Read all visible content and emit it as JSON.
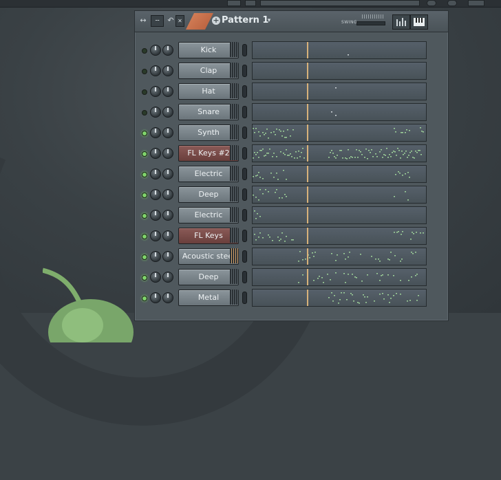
{
  "window": {
    "pattern_name": "Pattern 1",
    "swing_label": "SWING",
    "title_icons": [
      "resize-icon",
      "pattern-options-icon",
      "undo-icon",
      "close-icon",
      "arrow-icon"
    ]
  },
  "channels": [
    {
      "name": "Kick",
      "active": false,
      "style": "normal",
      "grip": "normal",
      "notes": "sparse"
    },
    {
      "name": "Clap",
      "active": false,
      "style": "normal",
      "grip": "normal",
      "notes": "none"
    },
    {
      "name": "Hat",
      "active": false,
      "style": "normal",
      "grip": "normal",
      "notes": "sparse"
    },
    {
      "name": "Snare",
      "active": false,
      "style": "normal",
      "grip": "normal",
      "notes": "sparse"
    },
    {
      "name": "Synth",
      "active": true,
      "style": "normal",
      "grip": "normal",
      "notes": "dense-edges"
    },
    {
      "name": "FL Keys #2",
      "active": true,
      "style": "red",
      "grip": "normal",
      "notes": "dense"
    },
    {
      "name": "Electric",
      "active": true,
      "style": "normal",
      "grip": "normal",
      "notes": "edges"
    },
    {
      "name": "Deep",
      "active": true,
      "style": "normal",
      "grip": "normal",
      "notes": "edges"
    },
    {
      "name": "Electric",
      "active": true,
      "style": "normal",
      "grip": "normal",
      "notes": "left"
    },
    {
      "name": "FL Keys",
      "active": true,
      "style": "red",
      "grip": "normal",
      "notes": "dense-edges"
    },
    {
      "name": "Acoustic steel",
      "active": true,
      "style": "normal",
      "grip": "orange",
      "notes": "center"
    },
    {
      "name": "Deep",
      "active": true,
      "style": "normal",
      "grip": "normal",
      "notes": "center"
    },
    {
      "name": "Metal",
      "active": true,
      "style": "normal",
      "grip": "normal",
      "notes": "right"
    }
  ]
}
